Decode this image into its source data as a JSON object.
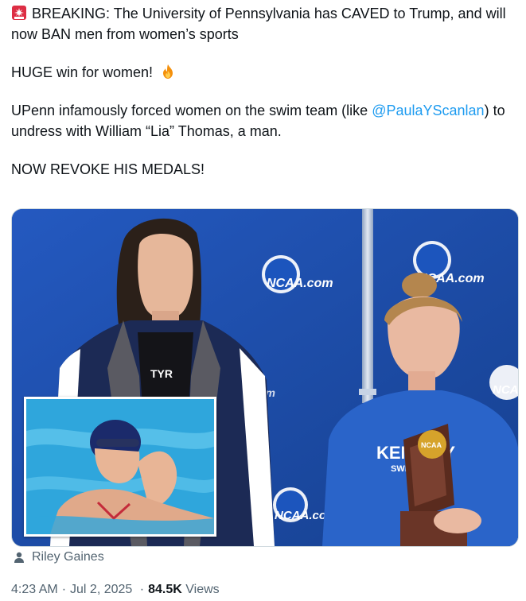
{
  "tweet": {
    "line1_icon": "rotating-light-icon",
    "line1": "BREAKING: The University of Pennsylvania has CAVED to Trump, and will now BAN men from women’s sports",
    "line2": "HUGE win for women!",
    "line2_icon": "fire-icon",
    "line3_before": "UPenn infamously forced women on the swim team (like ",
    "line3_mention": "@PaulaYScanlan",
    "line3_after": ") to undress with William “Lia” Thomas, a man.",
    "line4": "NOW REVOKE HIS MEDALS!"
  },
  "media": {
    "backdrop_logo_text": "NCAA.com",
    "backdrop_partial_text_left": "NCA",
    "backdrop_partial_text_mid": "om",
    "left_person_shirt_logo": "TYR",
    "right_person_shirt_text_line1": "KEN   CKY",
    "right_person_shirt_text_line2": "SWI    DIVING",
    "trophy_logo_text": "NCAA",
    "accent_blue": "#1f4fae"
  },
  "credit": {
    "icon": "person-icon",
    "name": "Riley Gaines"
  },
  "meta": {
    "time": "4:23 AM",
    "date": "Jul 2, 2025",
    "views_count": "84.5K",
    "views_label": "Views"
  }
}
